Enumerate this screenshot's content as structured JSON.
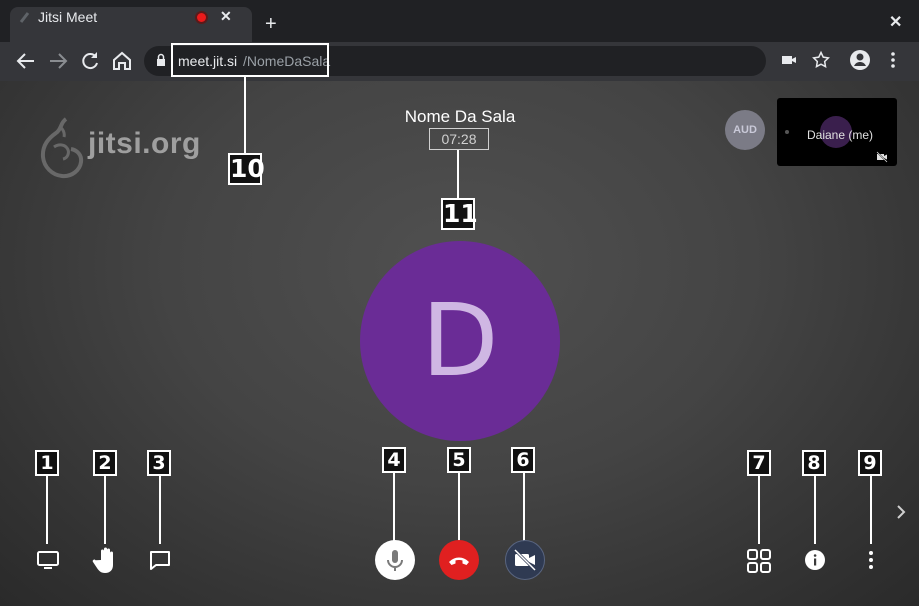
{
  "browser": {
    "tab_title": "Jitsi Meet",
    "tab_close": "✕",
    "new_tab": "+",
    "window_close": "✕",
    "url_host": "meet.jit.si",
    "url_path": "/NomeDaSala"
  },
  "meeting": {
    "watermark": "jitsi.org",
    "room_name": "Nome Da Sala",
    "timer": "07:28",
    "avatar_letter": "D",
    "avatar_color": "#6a2c96",
    "aud_badge": "AUD",
    "self_name": "Daiane (me)"
  },
  "callouts": [
    "1",
    "2",
    "3",
    "4",
    "5",
    "6",
    "7",
    "8",
    "9",
    "10",
    "11"
  ],
  "toolbar": {
    "left": [
      "screen-share-icon",
      "raise-hand-icon",
      "chat-icon"
    ],
    "center": [
      "microphone-icon",
      "hangup-icon",
      "camera-off-icon"
    ],
    "right": [
      "tile-view-icon",
      "info-icon",
      "more-vertical-icon"
    ]
  },
  "colors": {
    "hangup": "#e02020",
    "avatar": "#6a2c96"
  }
}
